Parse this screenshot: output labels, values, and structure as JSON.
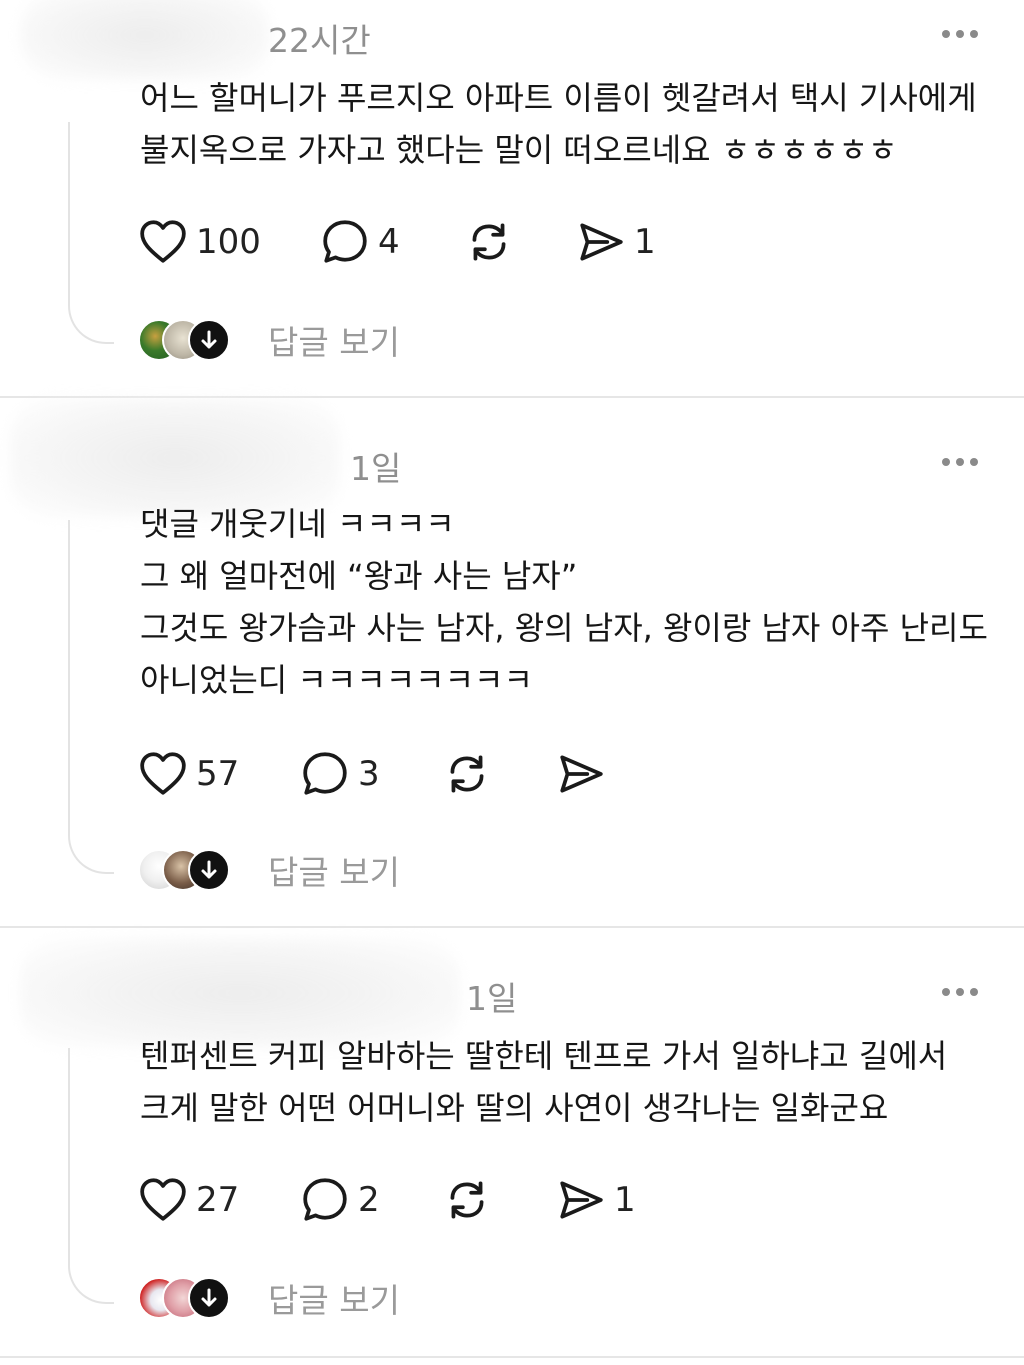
{
  "posts": [
    {
      "time": "22시간",
      "text": "어느 할머니가 푸르지오 아파트 이름이 헷갈려서 택시 기사에게\n불지옥으로 가자고 했다는 말이 떠오르네요 ㅎㅎㅎㅎㅎㅎ",
      "likes": "100",
      "comments": "4",
      "shares": "1",
      "view_replies_label": "답글 보기"
    },
    {
      "time": "1일",
      "text": "댓글 개웃기네 ㅋㅋㅋㅋ\n그 왜 얼마전에 “왕과 사는 남자”\n그것도 왕가슴과 사는 남자, 왕의 남자, 왕이랑 남자 아주 난리도\n아니었는디 ㅋㅋㅋㅋㅋㅋㅋㅋ",
      "likes": "57",
      "comments": "3",
      "shares": "",
      "view_replies_label": "답글 보기"
    },
    {
      "time": "1일",
      "text": "텐퍼센트 커피 알바하는 딸한테 텐프로 가서 일하냐고 길에서\n크게 말한 어떤 어머니와 딸의 사연이 생각나는 일화군요",
      "likes": "27",
      "comments": "2",
      "shares": "1",
      "view_replies_label": "답글 보기"
    }
  ],
  "icons": {
    "like": "heart-icon",
    "comment": "speech-bubble-icon",
    "repost": "repost-icon",
    "share": "send-icon",
    "more": "more-dots-icon",
    "expand": "arrow-down-icon"
  },
  "colors": {
    "text": "#161616",
    "muted": "#8f8f8f",
    "divider": "#e6e6e6",
    "thread_line": "#e3e3e3"
  }
}
